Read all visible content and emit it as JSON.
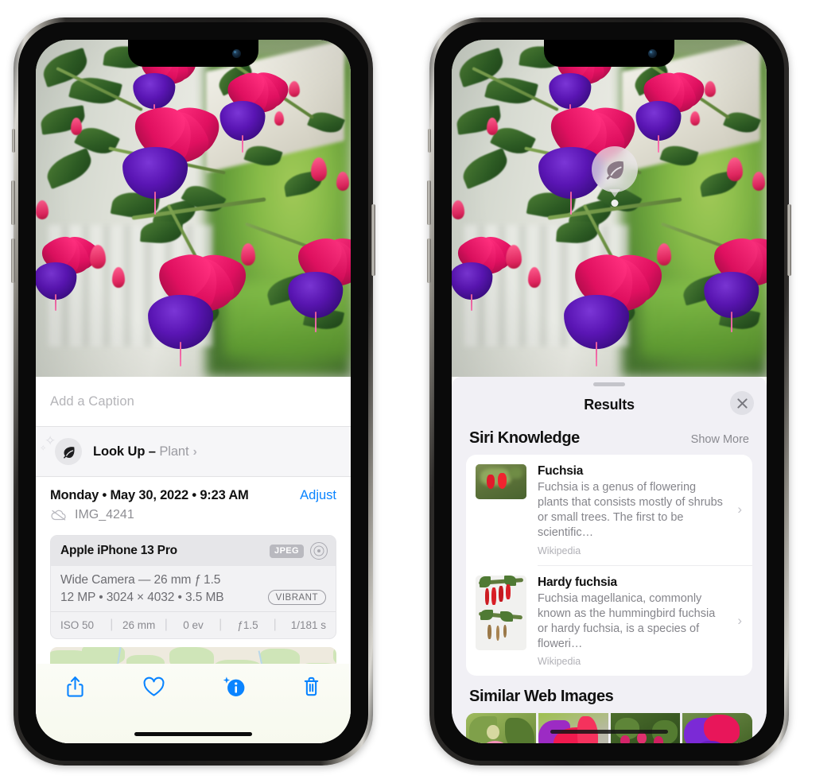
{
  "left_phone": {
    "photo_alt": "fuchsia-flowers-photo",
    "caption_placeholder": "Add a Caption",
    "lookup": {
      "icon": "leaf-icon",
      "label": "Look Up – ",
      "subject": "Plant",
      "chevron": "›"
    },
    "meta": {
      "date": "Monday • May 30, 2022 • 9:23 AM",
      "adjust": "Adjust",
      "cloud_icon": "cloud-slash-icon",
      "filename": "IMG_4241"
    },
    "camera_card": {
      "device": "Apple iPhone 13 Pro",
      "format_badge": "JPEG",
      "lens_icon": "lens-icon",
      "lens_line": "Wide Camera — 26 mm ƒ 1.5",
      "specs_line": "12 MP • 3024 × 4032 • 3.5 MB",
      "vibrant_badge": "VIBRANT",
      "exif": [
        "ISO 50",
        "26 mm",
        "0 ev",
        "ƒ1.5",
        "1/181 s"
      ],
      "exif_sep": "|"
    },
    "map": {
      "name": "location-map-thumbnail"
    },
    "toolbar": [
      {
        "name": "share-button",
        "icon": "share-icon"
      },
      {
        "name": "favorite-button",
        "icon": "heart-icon"
      },
      {
        "name": "info-button",
        "icon": "info-sparkle-icon"
      },
      {
        "name": "delete-button",
        "icon": "trash-icon"
      }
    ]
  },
  "right_phone": {
    "photo_alt": "fuchsia-flowers-photo",
    "visual_lookup_marker": {
      "icon": "leaf-icon"
    },
    "sheet": {
      "title": "Results",
      "close_icon": "close-icon",
      "sections": [
        {
          "title": "Siri Knowledge",
          "action": "Show More",
          "items": [
            {
              "title": "Fuchsia",
              "description": "Fuchsia is a genus of flowering plants that consists mostly of shrubs or small trees. The first to be scientific…",
              "source": "Wikipedia",
              "chevron": "›",
              "thumb": "fuchsia-thumbnail"
            },
            {
              "title": "Hardy fuchsia",
              "description": "Fuchsia magellanica, commonly known as the hummingbird fuchsia or hardy fuchsia, is a species of floweri…",
              "source": "Wikipedia",
              "chevron": "›",
              "thumb": "hardy-fuchsia-thumbnail"
            }
          ]
        },
        {
          "title": "Similar Web Images",
          "images": [
            "web-image-1",
            "web-image-2",
            "web-image-3",
            "web-image-4"
          ]
        }
      ]
    }
  },
  "colors": {
    "accent_blue": "#0a84ff",
    "sheet_bg": "#f1f0f5",
    "card_bg": "#ffffff",
    "muted_text": "#8a8a90",
    "badge_gray": "#b9b9bf"
  }
}
